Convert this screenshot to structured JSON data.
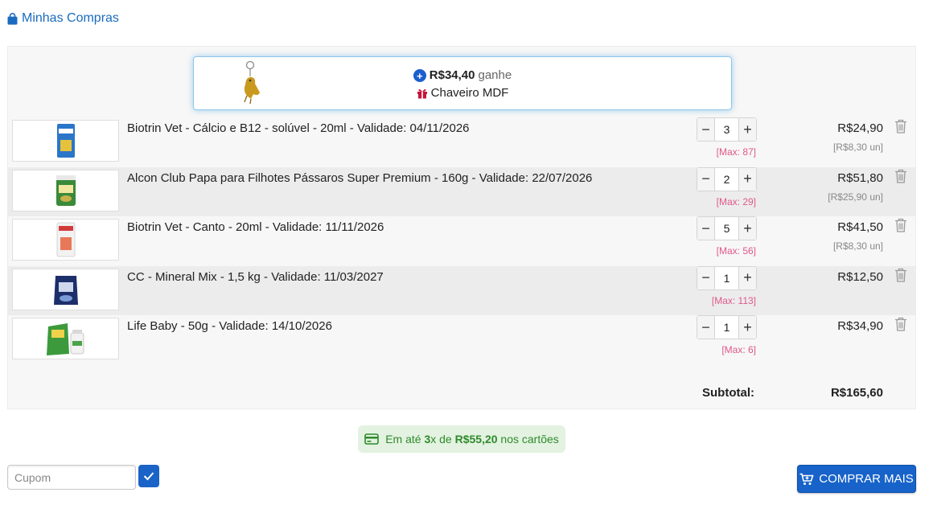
{
  "header": {
    "title": "Minhas Compras"
  },
  "promo": {
    "price": "R$34,40",
    "ganhe": "ganhe",
    "gift": "Chaveiro MDF"
  },
  "cart": {
    "items": [
      {
        "name": "Biotrin Vet - Cálcio e B12 - solúvel - 20ml - Validade: 04/11/2026",
        "qty": "3",
        "max": "[Max: 87]",
        "price": "R$24,90",
        "unit": "[R$8,30 un]"
      },
      {
        "name": "Alcon Club Papa para Filhotes Pássaros Super Premium - 160g - Validade: 22/07/2026",
        "qty": "2",
        "max": "[Max: 29]",
        "price": "R$51,80",
        "unit": "[R$25,90 un]"
      },
      {
        "name": "Biotrin Vet - Canto - 20ml - Validade: 11/11/2026",
        "qty": "5",
        "max": "[Max: 56]",
        "price": "R$41,50",
        "unit": "[R$8,30 un]"
      },
      {
        "name": "CC - Mineral Mix - 1,5 kg - Validade: 11/03/2027",
        "qty": "1",
        "max": "[Max: 113]",
        "price": "R$12,50",
        "unit": ""
      },
      {
        "name": "Life Baby - 50g - Validade: 14/10/2026",
        "qty": "1",
        "max": "[Max: 6]",
        "price": "R$34,90",
        "unit": ""
      }
    ],
    "subtotal_label": "Subtotal:",
    "subtotal_value": "R$165,60",
    "minus": "−",
    "plus": "+"
  },
  "installments": {
    "prefix": "Em até",
    "count": "3",
    "mid": "x de",
    "amount": "R$55,20",
    "suffix": "nos cartões"
  },
  "coupon": {
    "placeholder": "Cupom"
  },
  "buy_more": {
    "label": "COMPRAR MAIS"
  },
  "colors": {
    "accent": "#1763c9",
    "max_label": "#e0588a",
    "installment_green": "#2f8a2b"
  }
}
